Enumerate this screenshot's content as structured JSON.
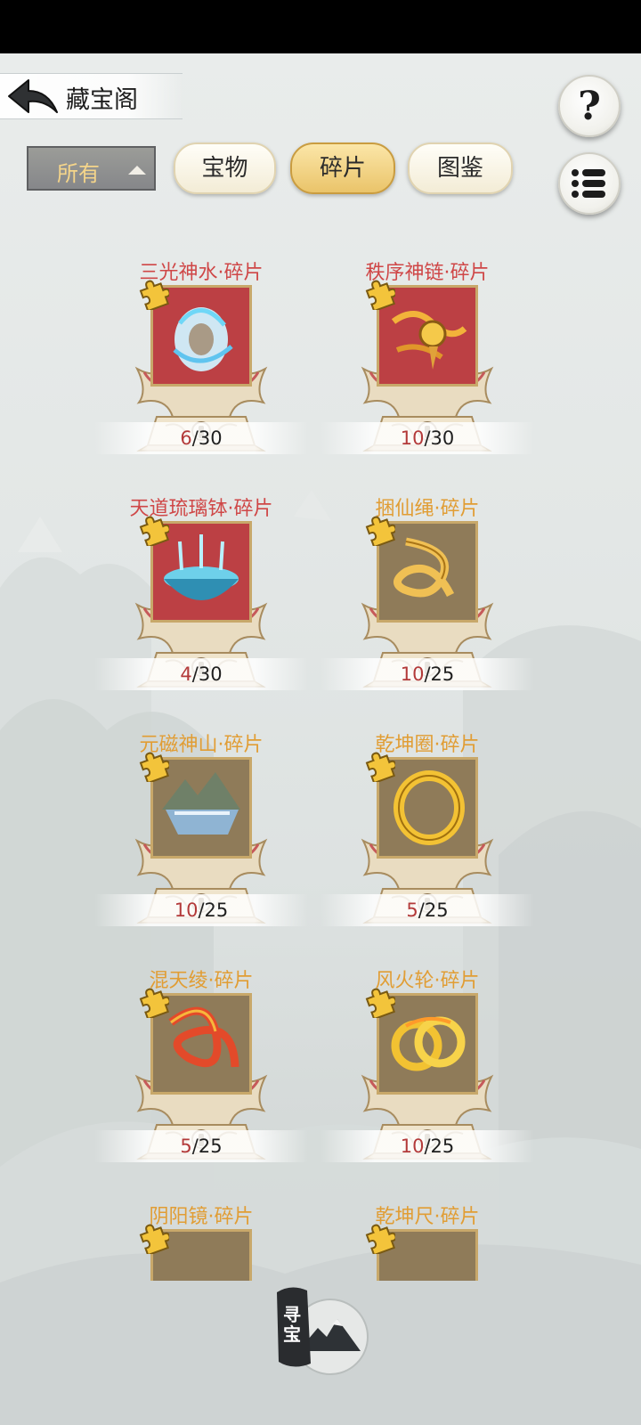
{
  "header": {
    "title": "藏宝阁"
  },
  "filter": {
    "selected": "所有"
  },
  "tabs": [
    {
      "label": "宝物",
      "active": false
    },
    {
      "label": "碎片",
      "active": true
    },
    {
      "label": "图鉴",
      "active": false
    }
  ],
  "items": [
    {
      "name": "三光神水·碎片",
      "current": "6",
      "separator": "/",
      "total": "30",
      "rarity": "red",
      "icon": "spirit-water-icon"
    },
    {
      "name": "秩序神链·碎片",
      "current": "10",
      "separator": "/",
      "total": "30",
      "rarity": "red",
      "icon": "golden-chain-icon"
    },
    {
      "name": "天道琉璃钵·碎片",
      "current": "4",
      "separator": "/",
      "total": "30",
      "rarity": "red",
      "icon": "glass-bowl-icon"
    },
    {
      "name": "捆仙绳·碎片",
      "current": "10",
      "separator": "/",
      "total": "25",
      "rarity": "gold",
      "icon": "binding-rope-icon"
    },
    {
      "name": "元磁神山·碎片",
      "current": "10",
      "separator": "/",
      "total": "25",
      "rarity": "gold",
      "icon": "floating-mountain-icon"
    },
    {
      "name": "乾坤圈·碎片",
      "current": "5",
      "separator": "/",
      "total": "25",
      "rarity": "gold",
      "icon": "golden-ring-icon"
    },
    {
      "name": "混天绫·碎片",
      "current": "5",
      "separator": "/",
      "total": "25",
      "rarity": "gold",
      "icon": "red-silk-icon"
    },
    {
      "name": "风火轮·碎片",
      "current": "10",
      "separator": "/",
      "total": "25",
      "rarity": "gold",
      "icon": "fire-wheels-icon"
    },
    {
      "name": "阴阳镜·碎片",
      "rarity": "gold",
      "icon": "yin-yang-mirror-icon"
    },
    {
      "name": "乾坤尺·碎片",
      "rarity": "gold",
      "icon": "cosmic-ruler-icon"
    }
  ],
  "seek_button": {
    "label": "寻宝"
  },
  "colors": {
    "red_name": "#cf4747",
    "gold_name": "#e19d34",
    "active_tab": "#eac46a",
    "count_current": "#b33a3a"
  }
}
